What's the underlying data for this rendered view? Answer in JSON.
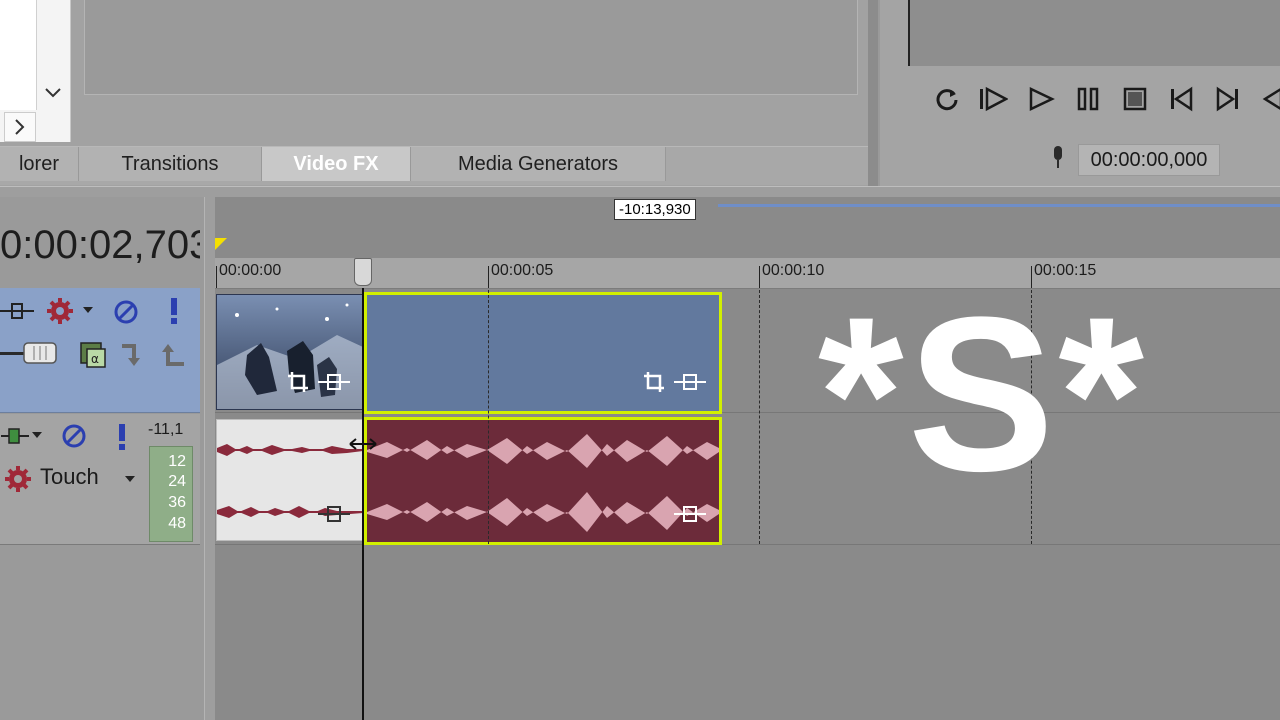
{
  "explorer": {
    "tabs": [
      {
        "label": "lorer"
      },
      {
        "label": "Transitions"
      },
      {
        "label": "Video FX"
      },
      {
        "label": "Media Generators"
      }
    ]
  },
  "transport": {
    "buttons": [
      "loop-icon",
      "play-from-start-icon",
      "play-icon",
      "pause-icon",
      "stop-icon",
      "previous-frame-icon",
      "next-frame-icon",
      "rewind-icon"
    ],
    "time_value": "00:00:00,000"
  },
  "timeline": {
    "current_time": "0:00:02,703",
    "cursor_tooltip": "-10:13,930",
    "ruler_labels": [
      "00:00:00",
      "00:00:05",
      "00:00:10",
      "00:00:15"
    ]
  },
  "audio_header": {
    "automation_mode": "Touch",
    "db_value": "-11,1",
    "meter_scale": [
      "12",
      "24",
      "36",
      "48"
    ]
  },
  "overlay": {
    "watermark": "*S*"
  },
  "colors": {
    "selected_clip_border": "#d2f000",
    "video_clip": "#62799e",
    "audio_clip": "#6c2b3a",
    "video_header": "#8aa1c8"
  }
}
